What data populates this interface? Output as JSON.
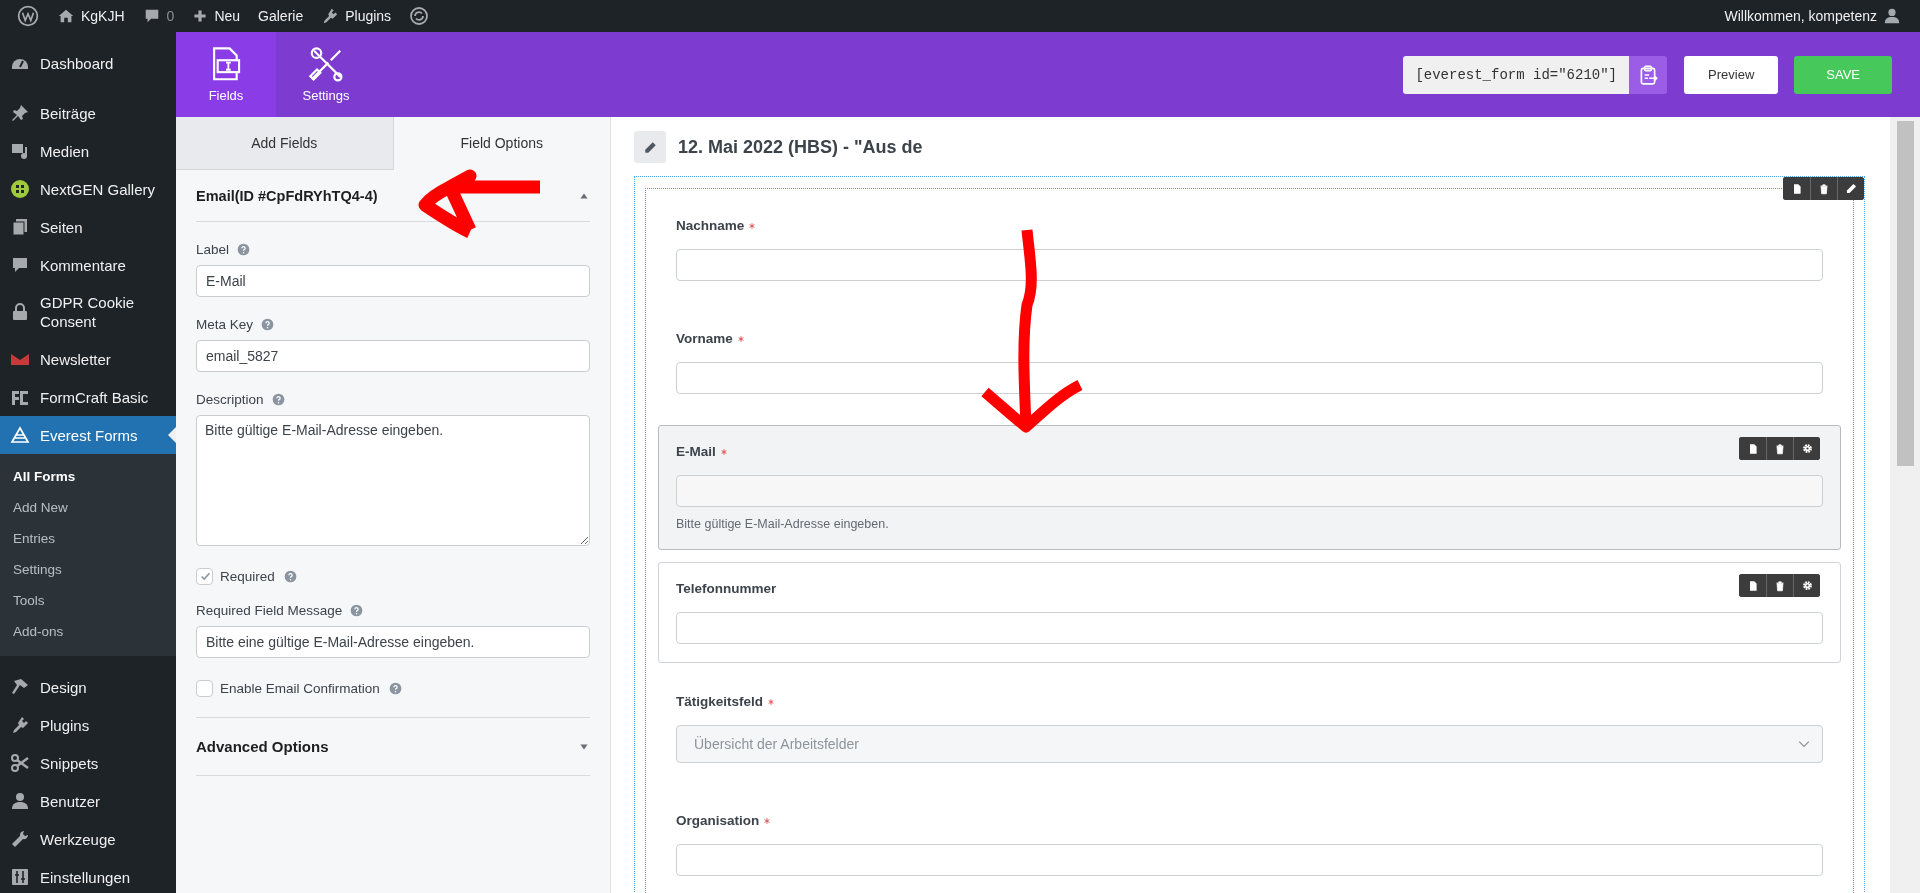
{
  "admin_bar": {
    "site": "KgKJH",
    "comments": "0",
    "new": "Neu",
    "links": [
      "Galerie",
      "Plugins"
    ],
    "greeting": "Willkommen, kompetenz"
  },
  "sidebar": {
    "items": [
      {
        "label": "Dashboard",
        "selected": false
      },
      {
        "label": "Beiträge",
        "selected": false
      },
      {
        "label": "Medien",
        "selected": false
      },
      {
        "label": "NextGEN Gallery",
        "selected": false
      },
      {
        "label": "Seiten",
        "selected": false
      },
      {
        "label": "Kommentare",
        "selected": false
      },
      {
        "label": "GDPR Cookie Consent",
        "selected": false
      },
      {
        "label": "Newsletter",
        "selected": false
      },
      {
        "label": "FormCraft Basic",
        "selected": false
      },
      {
        "label": "Everest Forms",
        "selected": true,
        "children": [
          {
            "label": "All Forms",
            "selected": true
          },
          {
            "label": "Add New",
            "selected": false
          },
          {
            "label": "Entries",
            "selected": false
          },
          {
            "label": "Settings",
            "selected": false
          },
          {
            "label": "Tools",
            "selected": false
          },
          {
            "label": "Add-ons",
            "selected": false
          }
        ]
      },
      {
        "label": "Design",
        "selected": false
      },
      {
        "label": "Plugins",
        "selected": false
      },
      {
        "label": "Snippets",
        "selected": false
      },
      {
        "label": "Benutzer",
        "selected": false
      },
      {
        "label": "Werkzeuge",
        "selected": false
      },
      {
        "label": "Einstellungen",
        "selected": false
      }
    ]
  },
  "builder": {
    "tabs": [
      {
        "label": "Fields",
        "selected": true
      },
      {
        "label": "Settings",
        "selected": false
      }
    ],
    "shortcode": "[everest_form id=\"6210\"]",
    "preview": "Preview",
    "save": "SAVE"
  },
  "panel": {
    "tabs": [
      {
        "label": "Add Fields",
        "selected": false
      },
      {
        "label": "Field Options",
        "selected": true
      }
    ],
    "section": {
      "title": "Email(ID #CpFdRYhTQ4-4)",
      "expanded": true
    },
    "options": [
      {
        "kind": "input",
        "label": "Label",
        "value": "E-Mail"
      },
      {
        "kind": "input",
        "label": "Meta Key",
        "value": "email_5827"
      },
      {
        "kind": "textarea",
        "label": "Description",
        "value": "Bitte gültige E-Mail-Adresse eingeben."
      },
      {
        "kind": "checkbox",
        "label": "Required",
        "checked": true
      },
      {
        "kind": "input",
        "label": "Required Field Message",
        "value": "Bitte eine gültige E-Mail-Adresse eingeben."
      },
      {
        "kind": "checkbox",
        "label": "Enable Email Confirmation",
        "checked": false
      }
    ],
    "advanced": {
      "title": "Advanced Options",
      "expanded": false
    }
  },
  "form": {
    "title": "12. Mai 2022 (HBS) - \"Aus de",
    "fields": [
      {
        "kind": "text",
        "label": "Nachname",
        "required": true,
        "selected": false,
        "hovered": false
      },
      {
        "kind": "text",
        "label": "Vorname",
        "required": true,
        "selected": false,
        "hovered": false
      },
      {
        "kind": "text",
        "label": "E-Mail",
        "required": true,
        "selected": true,
        "hovered": false,
        "description": "Bitte gültige E-Mail-Adresse eingeben."
      },
      {
        "kind": "text",
        "label": "Telefonnummer",
        "required": false,
        "selected": false,
        "hovered": true
      },
      {
        "kind": "select",
        "label": "Tätigkeitsfeld",
        "required": true,
        "selected": false,
        "hovered": false,
        "placeholder": "Übersicht der Arbeitsfelder"
      },
      {
        "kind": "text",
        "label": "Organisation",
        "required": true,
        "selected": false,
        "hovered": false
      }
    ]
  }
}
